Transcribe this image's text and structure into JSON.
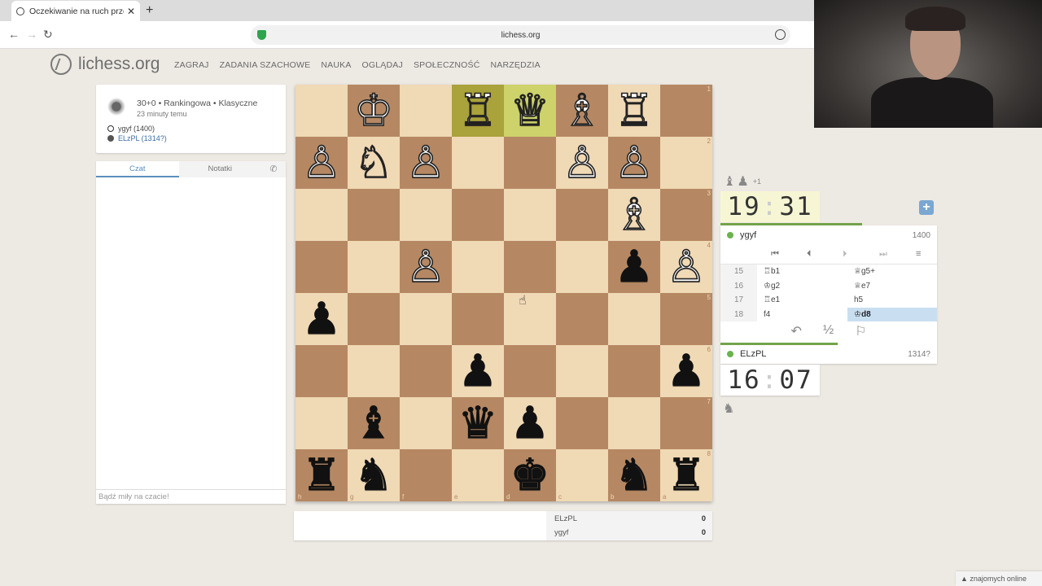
{
  "browser": {
    "tab_title": "Oczekiwanie na ruch przeciwnika",
    "tab_close": "✕",
    "new_tab": "+",
    "url": "lichess.org"
  },
  "site": {
    "logo_text": "lichess.org",
    "nav": [
      "ZAGRAJ",
      "ZADANIA SZACHOWE",
      "NAUKA",
      "OGLĄDAJ",
      "SPOŁECZNOŚĆ",
      "NARZĘDZIA"
    ]
  },
  "game_info": {
    "line1": "30+0 • Rankingowa • Klasyczne",
    "line2": "23 minuty temu",
    "white_player": "ygyf (1400)",
    "black_player": "ELzPL (1314?)"
  },
  "chat": {
    "tab_chat": "Czat",
    "tab_notes": "Notatki",
    "input_placeholder": "Bądź miły na czacie!"
  },
  "board": {
    "orientation": "black",
    "rank_labels": [
      "1",
      "2",
      "3",
      "4",
      "5",
      "6",
      "7",
      "8"
    ],
    "file_labels": [
      "h",
      "g",
      "f",
      "e",
      "d",
      "c",
      "b",
      "a"
    ],
    "highlight_squares": [
      "e1",
      "d1"
    ],
    "pieces": [
      {
        "sq": "g1",
        "p": "K",
        "c": "w"
      },
      {
        "sq": "e1",
        "p": "R",
        "c": "w"
      },
      {
        "sq": "d1",
        "p": "Q",
        "c": "w"
      },
      {
        "sq": "c1",
        "p": "B",
        "c": "w"
      },
      {
        "sq": "b1",
        "p": "R",
        "c": "w"
      },
      {
        "sq": "h2",
        "p": "P",
        "c": "w"
      },
      {
        "sq": "g2",
        "p": "N",
        "c": "w"
      },
      {
        "sq": "f2",
        "p": "P",
        "c": "w"
      },
      {
        "sq": "c2",
        "p": "P",
        "c": "w"
      },
      {
        "sq": "b2",
        "p": "P",
        "c": "w"
      },
      {
        "sq": "b3",
        "p": "B",
        "c": "w"
      },
      {
        "sq": "f4",
        "p": "P",
        "c": "w"
      },
      {
        "sq": "b4",
        "p": "P",
        "c": "b"
      },
      {
        "sq": "a4",
        "p": "P",
        "c": "w"
      },
      {
        "sq": "h5",
        "p": "P",
        "c": "b"
      },
      {
        "sq": "e6",
        "p": "P",
        "c": "b"
      },
      {
        "sq": "a6",
        "p": "P",
        "c": "b"
      },
      {
        "sq": "g7",
        "p": "B",
        "c": "b"
      },
      {
        "sq": "e7",
        "p": "Q",
        "c": "b"
      },
      {
        "sq": "d7",
        "p": "P",
        "c": "b"
      },
      {
        "sq": "h8",
        "p": "R",
        "c": "b"
      },
      {
        "sq": "g8",
        "p": "N",
        "c": "b"
      },
      {
        "sq": "d8",
        "p": "K",
        "c": "b"
      },
      {
        "sq": "b8",
        "p": "N",
        "c": "b"
      },
      {
        "sq": "a8",
        "p": "R",
        "c": "b"
      }
    ]
  },
  "crosstable": {
    "rows": [
      {
        "name": "ELzPL",
        "score": "0"
      },
      {
        "name": "ygyf",
        "score": "0"
      }
    ]
  },
  "panel": {
    "material_top_plus": "+1",
    "top_clock": {
      "min": "19",
      "sec": "31"
    },
    "bottom_clock": {
      "min": "16",
      "sec": "07"
    },
    "top_player": {
      "name": "ygyf",
      "rating": "1400"
    },
    "bottom_player": {
      "name": "ELzPL",
      "rating": "1314?"
    },
    "moves": [
      {
        "n": "15",
        "w": "♖b1",
        "b": "♕g5+"
      },
      {
        "n": "16",
        "w": "♔g2",
        "b": "♕e7"
      },
      {
        "n": "17",
        "w": "♖e1",
        "b": "h5"
      },
      {
        "n": "18",
        "w": "f4",
        "b": "♔d8"
      }
    ],
    "draw_label": "½"
  },
  "footer": {
    "friends_online": "▲ znajomych online"
  },
  "colors": {
    "light_square": "#f0d9b5",
    "dark_square": "#b58863",
    "online_dot": "#6bb34d",
    "accent": "#5b8fbd"
  }
}
